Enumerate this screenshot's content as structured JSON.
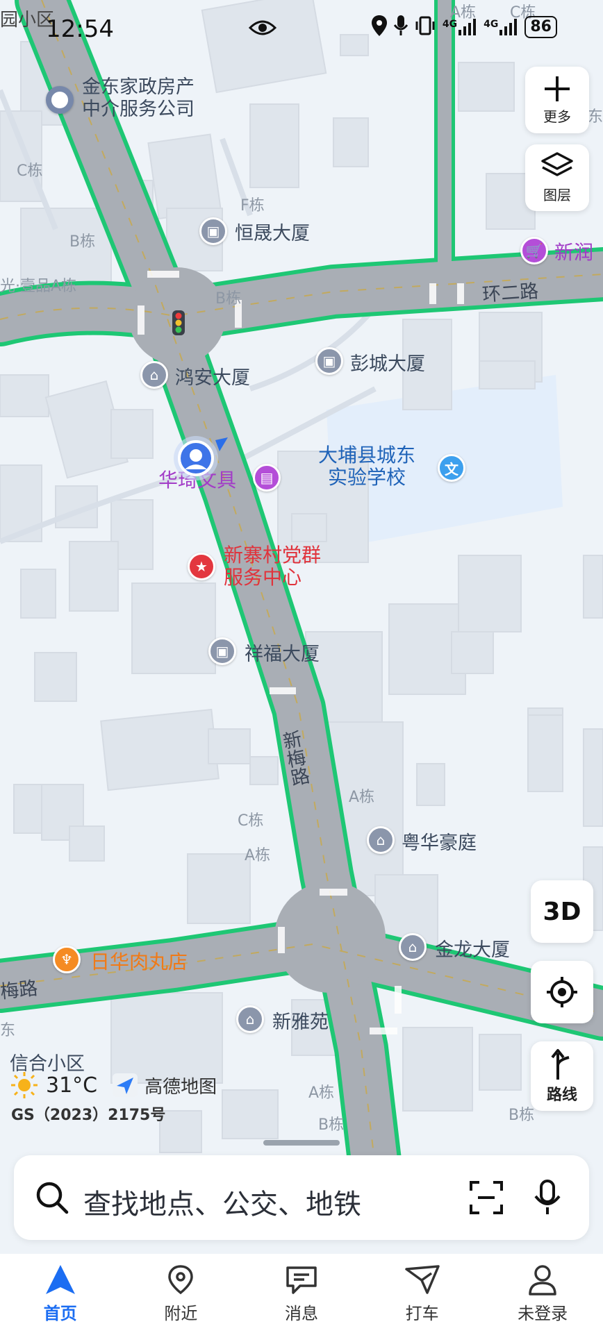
{
  "status_bar": {
    "time": "12:54",
    "battery": "86",
    "network_1": "4G",
    "network_2": "4G",
    "icons": [
      "eye-icon",
      "location-icon",
      "mic-icon",
      "vibrate-icon",
      "signal-icon",
      "signal-icon",
      "battery-icon"
    ]
  },
  "map": {
    "buildings": {
      "top_left": "园小区",
      "top_right_a": "A栋",
      "top_right_c": "C栋",
      "right_edge": "东",
      "c_left": "C栋",
      "b_left": "B栋",
      "guang": "光·壹品A栋",
      "f_dong": "F栋",
      "b_road": "B栋",
      "a_mid": "A栋",
      "c_mid": "C栋",
      "a_mid2": "A栋",
      "a_bottom": "A栋",
      "b_bottom": "B栋",
      "b_bottom_right": "B栋",
      "dong_left": "东"
    },
    "pois": {
      "jindong": "金东家政房产\n中介服务公司",
      "hengsheng": "恒晟大厦",
      "xinrun": "新润",
      "hongan": "鸿安大厦",
      "pengcheng": "彭城大厦",
      "school": "大埔县城东\n实验学校",
      "wenju": "华琦文具",
      "dangqun": "新寨村党群\n服务中心",
      "xiangfu": "祥福大厦",
      "yuehua": "粤华豪庭",
      "jinlong": "金龙大厦",
      "rouwan": "日华肉丸店",
      "xinya": "新雅苑",
      "xinhe": "信合小区"
    },
    "roads": {
      "huaner": "环二路",
      "xinmei": "新梅路",
      "mei_left": "梅路"
    },
    "pins": {
      "school_pin": "文"
    }
  },
  "controls": {
    "more_label": "更多",
    "layers_label": "图层",
    "three_d_label": "3D",
    "route_label": "路线"
  },
  "weather": {
    "temp": "31°C",
    "brand": "高德地图"
  },
  "attribution": "GS（2023）2175号",
  "search": {
    "placeholder": "查找地点、公交、地铁"
  },
  "nav": {
    "home": "首页",
    "nearby": "附近",
    "messages": "消息",
    "taxi": "打车",
    "login": "未登录"
  },
  "colors": {
    "accent": "#1b6df2",
    "traffic_green": "#1ec774",
    "road_gray": "#a9aeb5",
    "map_bg": "#eef3f8"
  }
}
